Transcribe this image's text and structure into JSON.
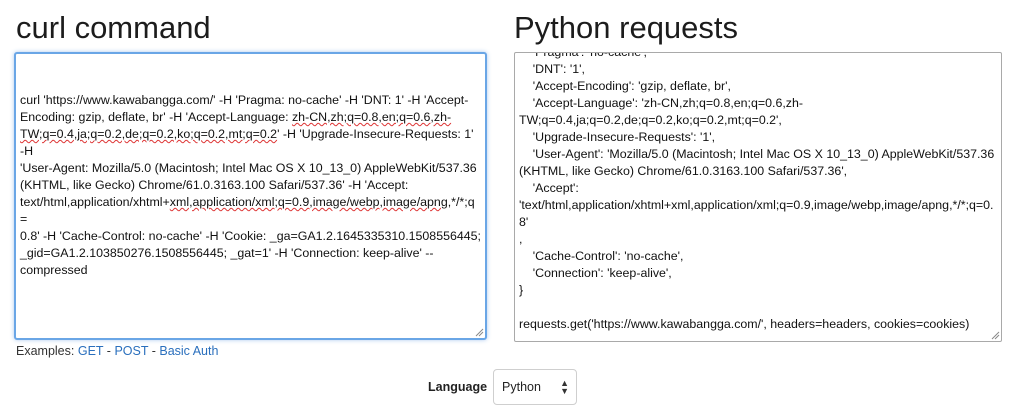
{
  "left_panel": {
    "title": "curl command",
    "lines": [
      "curl 'https://www.kawabangga.com/' -H 'Pragma: no-cache' -H 'DNT: 1' -H 'Accept-",
      "Encoding: gzip, deflate, br' -H 'Accept-Language: zh-CN,zh;q=0.8,en;q=0.6,zh-",
      "TW;q=0.4,ja;q=0.2,de;q=0.2,ko;q=0.2,mt;q=0.2' -H 'Upgrade-Insecure-Requests: 1' -H",
      "'User-Agent: Mozilla/5.0 (Macintosh; Intel Mac OS X 10_13_0) AppleWebKit/537.36",
      "(KHTML, like Gecko) Chrome/61.0.3163.100 Safari/537.36' -H 'Accept:",
      "text/html,application/xhtml+xml,application/xml;q=0.9,image/webp,image/apng,*/*;q=",
      "0.8' -H 'Cache-Control: no-cache' -H 'Cookie: _ga=GA1.2.1645335310.1508556445;",
      "_gid=GA1.2.103850276.1508556445; _gat=1' -H 'Connection: keep-alive' --",
      "compressed"
    ]
  },
  "right_panel": {
    "title": "Python requests",
    "lines": [
      "    'Pragma': 'no-cache',",
      "    'DNT': '1',",
      "    'Accept-Encoding': 'gzip, deflate, br',",
      "    'Accept-Language': 'zh-CN,zh;q=0.8,en;q=0.6,zh-",
      "TW;q=0.4,ja;q=0.2,de;q=0.2,ko;q=0.2,mt;q=0.2',",
      "    'Upgrade-Insecure-Requests': '1',",
      "    'User-Agent': 'Mozilla/5.0 (Macintosh; Intel Mac OS X 10_13_0) AppleWebKit/537.36",
      "(KHTML, like Gecko) Chrome/61.0.3163.100 Safari/537.36',",
      "    'Accept':",
      "'text/html,application/xhtml+xml,application/xml;q=0.9,image/webp,image/apng,*/*;q=0.8'",
      ",",
      "    'Cache-Control': 'no-cache',",
      "    'Connection': 'keep-alive',",
      "}",
      "",
      "requests.get('https://www.kawabangga.com/', headers=headers, cookies=cookies)"
    ]
  },
  "examples": {
    "prefix": "Examples: ",
    "sep": " - ",
    "links": [
      "GET",
      "POST",
      "Basic Auth"
    ]
  },
  "language": {
    "label": "Language",
    "selected": "Python"
  },
  "colors": {
    "link": "#2a6fbd",
    "focus_border": "#6aa6e6",
    "spellcheck_underline": "#d33"
  },
  "icons": {
    "select_caret": "updown-caret-icon",
    "resize_grip": "resize-grip-icon"
  }
}
